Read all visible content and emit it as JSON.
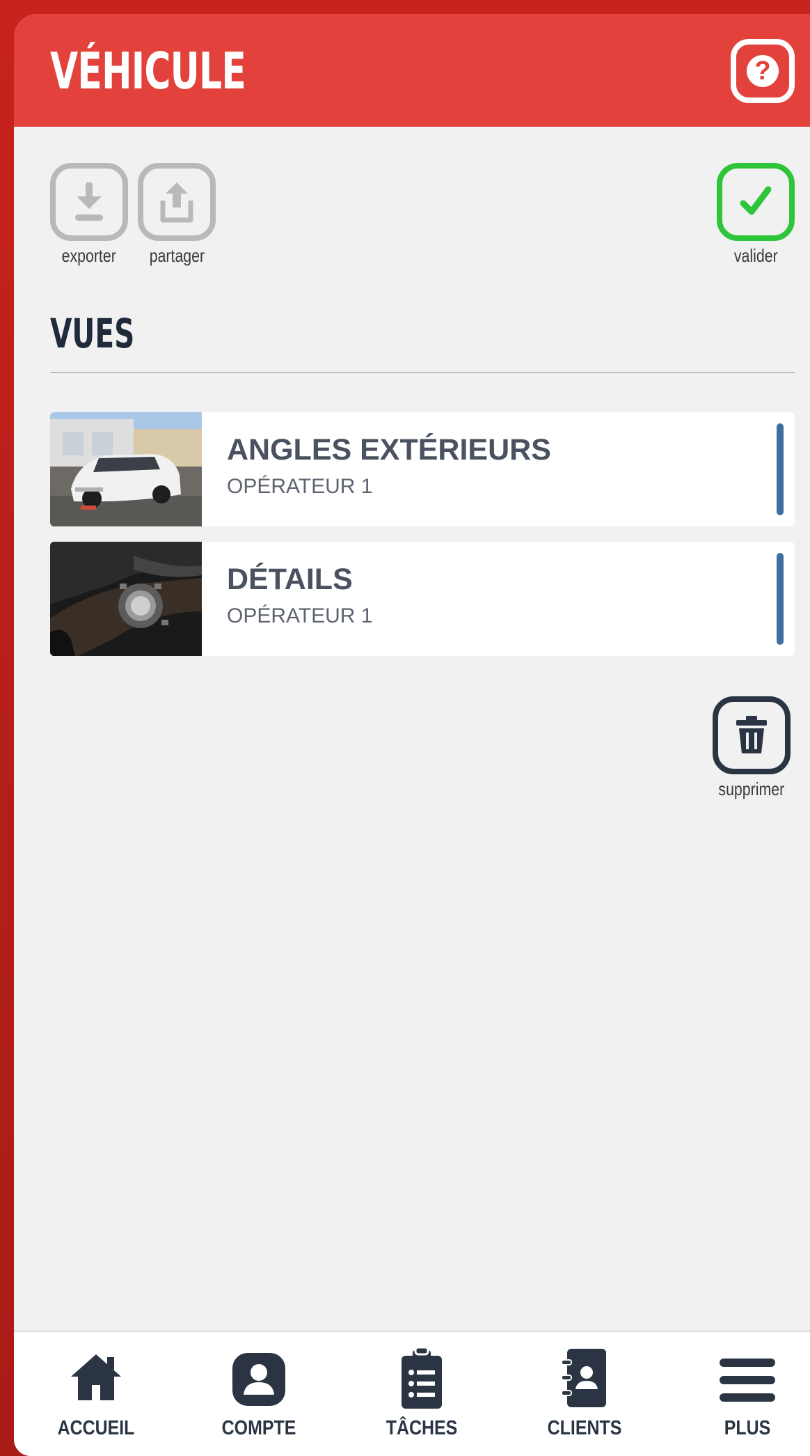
{
  "header": {
    "title": "VÉHICULE",
    "help_icon": "question-mark-icon",
    "help_glyph": "?"
  },
  "toolbar": {
    "export_label": "exporter",
    "share_label": "partager",
    "validate_label": "valider",
    "delete_label": "supprimer"
  },
  "views_section": {
    "title": "VUES",
    "items": [
      {
        "name": "ANGLES EXTÉRIEURS",
        "operator": "OPÉRATEUR 1"
      },
      {
        "name": "DÉTAILS",
        "operator": "OPÉRATEUR 1"
      }
    ]
  },
  "nav": {
    "items": [
      {
        "label": "ACCUEIL",
        "icon": "home-icon"
      },
      {
        "label": "COMPTE",
        "icon": "user-icon"
      },
      {
        "label": "TÂCHES",
        "icon": "clipboard-list-icon"
      },
      {
        "label": "CLIENTS",
        "icon": "address-book-icon"
      },
      {
        "label": "PLUS",
        "icon": "hamburger-menu-icon"
      }
    ]
  },
  "colors": {
    "header": "#e2423b",
    "validate": "#2fc53b",
    "handle": "#3f6fa0",
    "dark": "#2a3443"
  }
}
